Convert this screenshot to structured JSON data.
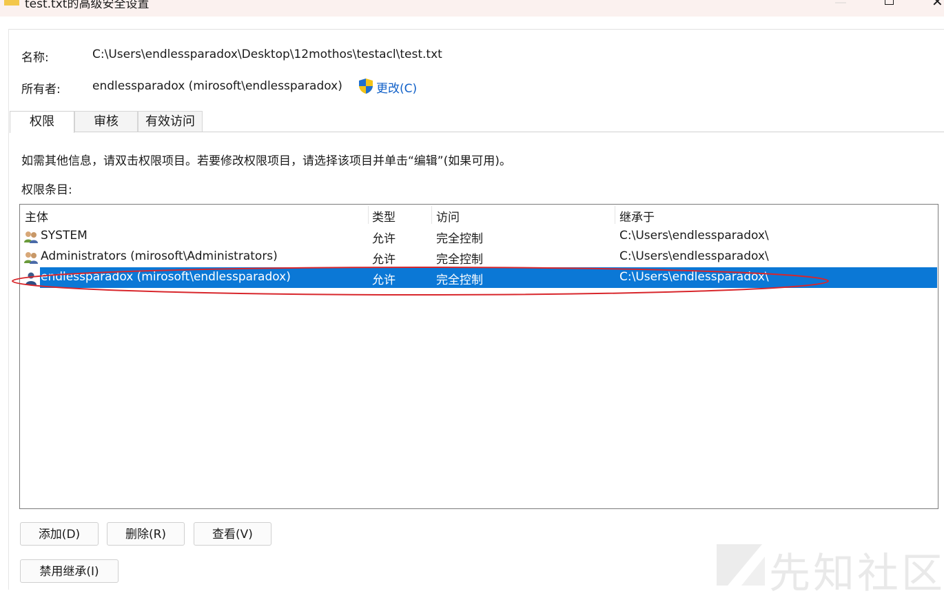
{
  "window": {
    "title": "test.txt的高级安全设置"
  },
  "object": {
    "name_label": "名称:",
    "name_value": "C:\\Users\\endlessparadox\\Desktop\\12mothos\\testacl\\test.txt",
    "owner_label": "所有者:",
    "owner_value": "endlessparadox (mirosoft\\endlessparadox)",
    "change_label": "更改(C)"
  },
  "tabs": [
    {
      "label": "权限",
      "active": true
    },
    {
      "label": "审核",
      "active": false
    },
    {
      "label": "有效访问",
      "active": false
    }
  ],
  "permissions": {
    "info_text": "如需其他信息，请双击权限项目。若要修改权限项目，请选择该项目并单击“编辑”(如果可用)。",
    "entries_label": "权限条目:",
    "columns": [
      "主体",
      "类型",
      "访问",
      "继承于"
    ],
    "rows": [
      {
        "principal": "SYSTEM",
        "type": "允许",
        "access": "完全控制",
        "inherited_from": "C:\\Users\\endlessparadox\\",
        "icon": "group-icon",
        "selected": false
      },
      {
        "principal": "Administrators (mirosoft\\Administrators)",
        "type": "允许",
        "access": "完全控制",
        "inherited_from": "C:\\Users\\endlessparadox\\",
        "icon": "group-icon",
        "selected": false
      },
      {
        "principal": "endlessparadox (mirosoft\\endlessparadox)",
        "type": "允许",
        "access": "完全控制",
        "inherited_from": "C:\\Users\\endlessparadox\\",
        "icon": "user-icon",
        "selected": true
      }
    ]
  },
  "buttons": {
    "add": "添加(D)",
    "remove": "删除(R)",
    "view": "查看(V)",
    "disable_inheritance": "禁用继承(I)"
  },
  "watermark": {
    "text": "先知社区"
  },
  "colors": {
    "selection": "#0b78d6",
    "link": "#1060c8",
    "annotation": "#d8262b"
  }
}
